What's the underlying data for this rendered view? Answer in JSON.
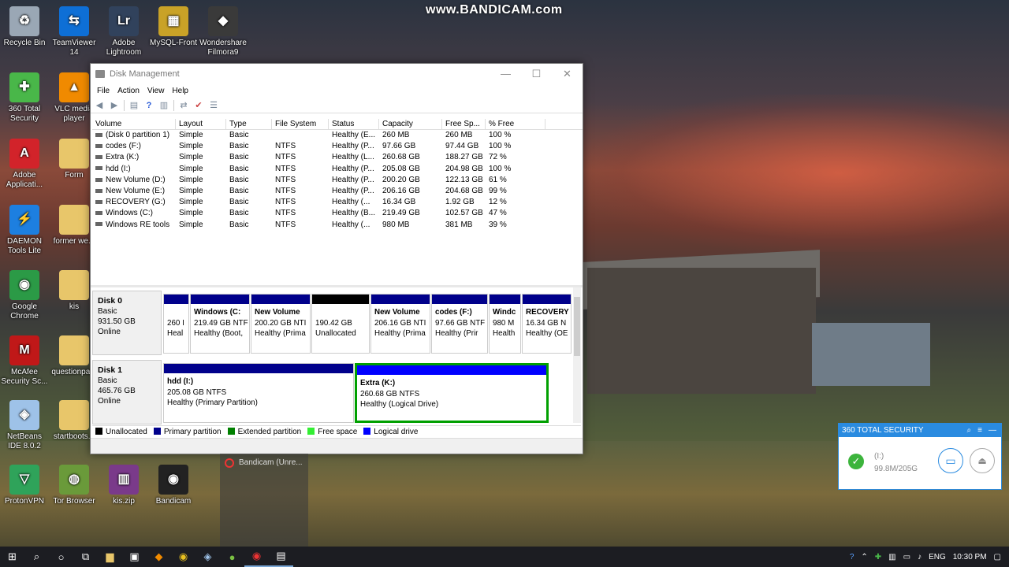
{
  "watermark": "www.BANDICAM.com",
  "desktop_icons": [
    {
      "label": "Recycle Bin",
      "icon": "recycle-bin-icon",
      "color": "#9aa7b5"
    },
    {
      "label": "TeamViewer 14",
      "icon": "teamviewer-icon",
      "color": "#0e6fd6"
    },
    {
      "label": "Adobe Lightroom",
      "icon": "lightroom-icon",
      "color": "#31425c"
    },
    {
      "label": "MySQL-Front",
      "icon": "mysql-front-icon",
      "color": "#c9a227"
    },
    {
      "label": "Wondershare Filmora9",
      "icon": "filmora-icon",
      "color": "#3a3a3a"
    },
    {
      "label": "360 Total Security",
      "icon": "360-security-icon",
      "color": "#49b749"
    },
    {
      "label": "VLC media player",
      "icon": "vlc-icon",
      "color": "#f08a00"
    },
    {
      "label": "Adobe Applicati...",
      "icon": "adobe-icon",
      "color": "#d2232a"
    },
    {
      "label": "Form",
      "icon": "folder-icon",
      "color": "#e8c66a"
    },
    {
      "label": "DAEMON Tools Lite",
      "icon": "daemon-tools-icon",
      "color": "#1d7fe0"
    },
    {
      "label": "former we...",
      "icon": "folder-icon",
      "color": "#e8c66a"
    },
    {
      "label": "Google Chrome",
      "icon": "chrome-icon",
      "color": "#2b9a46"
    },
    {
      "label": "kis",
      "icon": "folder-icon",
      "color": "#e8c66a"
    },
    {
      "label": "McAfee Security Sc...",
      "icon": "mcafee-icon",
      "color": "#c01818"
    },
    {
      "label": "questionpa...",
      "icon": "folder-icon",
      "color": "#e8c66a"
    },
    {
      "label": "NetBeans IDE 8.0.2",
      "icon": "netbeans-icon",
      "color": "#9ec2e8"
    },
    {
      "label": "startboots...",
      "icon": "folder-icon",
      "color": "#e8c66a"
    },
    {
      "label": "ProtonVPN",
      "icon": "protonvpn-icon",
      "color": "#2fa35a"
    },
    {
      "label": "Tor Browser",
      "icon": "tor-browser-icon",
      "color": "#6a9a3a"
    },
    {
      "label": "kis.zip",
      "icon": "winrar-icon",
      "color": "#7a3a8a"
    },
    {
      "label": "Bandicam",
      "icon": "bandicam-icon",
      "color": "#222222"
    }
  ],
  "window": {
    "title": "Disk Management",
    "menu": [
      "File",
      "Action",
      "View",
      "Help"
    ],
    "columns": [
      "Volume",
      "Layout",
      "Type",
      "File System",
      "Status",
      "Capacity",
      "Free Sp...",
      "% Free"
    ],
    "rows": [
      [
        "(Disk 0 partition 1)",
        "Simple",
        "Basic",
        "",
        "Healthy (E...",
        "260 MB",
        "260 MB",
        "100 %"
      ],
      [
        "codes (F:)",
        "Simple",
        "Basic",
        "NTFS",
        "Healthy (P...",
        "97.66 GB",
        "97.44 GB",
        "100 %"
      ],
      [
        "Extra (K:)",
        "Simple",
        "Basic",
        "NTFS",
        "Healthy (L...",
        "260.68 GB",
        "188.27 GB",
        "72 %"
      ],
      [
        "hdd (I:)",
        "Simple",
        "Basic",
        "NTFS",
        "Healthy (P...",
        "205.08 GB",
        "204.98 GB",
        "100 %"
      ],
      [
        "New Volume (D:)",
        "Simple",
        "Basic",
        "NTFS",
        "Healthy (P...",
        "200.20 GB",
        "122.13 GB",
        "61 %"
      ],
      [
        "New Volume (E:)",
        "Simple",
        "Basic",
        "NTFS",
        "Healthy (P...",
        "206.16 GB",
        "204.68 GB",
        "99 %"
      ],
      [
        "RECOVERY (G:)",
        "Simple",
        "Basic",
        "NTFS",
        "Healthy (...",
        "16.34 GB",
        "1.92 GB",
        "12 %"
      ],
      [
        "Windows (C:)",
        "Simple",
        "Basic",
        "NTFS",
        "Healthy (B...",
        "219.49 GB",
        "102.57 GB",
        "47 %"
      ],
      [
        "Windows RE tools",
        "Simple",
        "Basic",
        "NTFS",
        "Healthy (...",
        "980 MB",
        "381 MB",
        "39 %"
      ]
    ],
    "disks": [
      {
        "name": "Disk 0",
        "type": "Basic",
        "size": "931.50 GB",
        "state": "Online",
        "partitions": [
          {
            "name": "",
            "size": "260 I",
            "status": "Heal",
            "kind": "primary"
          },
          {
            "name": "Windows  (C:",
            "size": "219.49 GB NTF",
            "status": "Healthy (Boot,",
            "kind": "primary"
          },
          {
            "name": "New Volume",
            "size": "200.20 GB NTI",
            "status": "Healthy (Prima",
            "kind": "primary"
          },
          {
            "name": "",
            "size": "190.42 GB",
            "status": "Unallocated",
            "kind": "unallocated"
          },
          {
            "name": "New Volume",
            "size": "206.16 GB NTI",
            "status": "Healthy (Prima",
            "kind": "primary"
          },
          {
            "name": "codes  (F:)",
            "size": "97.66 GB NTF",
            "status": "Healthy (Prir",
            "kind": "primary"
          },
          {
            "name": "Windc",
            "size": "980 M",
            "status": "Health",
            "kind": "primary"
          },
          {
            "name": "RECOVERY",
            "size": "16.34 GB N",
            "status": "Healthy (OE",
            "kind": "primary"
          }
        ]
      },
      {
        "name": "Disk 1",
        "type": "Basic",
        "size": "465.76 GB",
        "state": "Online",
        "partitions": [
          {
            "name": "hdd  (I:)",
            "size": "205.08 GB NTFS",
            "status": "Healthy (Primary Partition)",
            "kind": "primary"
          },
          {
            "name": "Extra  (K:)",
            "size": "260.68 GB NTFS",
            "status": "Healthy (Logical Drive)",
            "kind": "logical"
          }
        ]
      }
    ],
    "legend": [
      {
        "label": "Unallocated",
        "color": "#000000"
      },
      {
        "label": "Primary partition",
        "color": "#00008b"
      },
      {
        "label": "Extended partition",
        "color": "#008000"
      },
      {
        "label": "Free space",
        "color": "#33ee33"
      },
      {
        "label": "Logical drive",
        "color": "#0000ff"
      }
    ]
  },
  "bandicam_preview": {
    "title": "Bandicam (Unre..."
  },
  "popup_360": {
    "title": "360 TOTAL SECURITY",
    "drive": "(I:)",
    "usage": "99.8M/205G"
  },
  "taskbar": {
    "language": "ENG",
    "time": "10:30 PM"
  }
}
